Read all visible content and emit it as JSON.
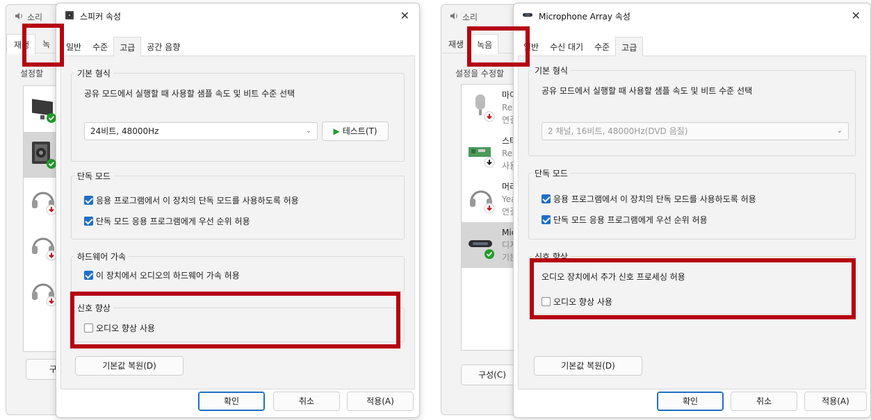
{
  "left": {
    "sound": {
      "title": "소리",
      "tabs": [
        "재생",
        "녹"
      ],
      "subtitle": "설정할",
      "button": "구성",
      "devices": [
        {
          "icon": "monitor-icon",
          "status": "green-check"
        },
        {
          "icon": "speaker-icon",
          "status": "green-check"
        },
        {
          "icon": "headset-icon",
          "status": "red-down"
        },
        {
          "icon": "headset-icon",
          "status": "red-down"
        },
        {
          "icon": "headset-icon",
          "status": "red-down"
        }
      ]
    },
    "dialog": {
      "title": "스피커 속성",
      "close": "✕",
      "tabs": [
        "일반",
        "수준",
        "고급",
        "공간 음향"
      ],
      "active_tab": 2,
      "default_format": {
        "legend": "기본 형식",
        "description": "공유 모드에서 실행할 때 사용할 샘플 속도 및 비트 수준 선택",
        "select_value": "24비트, 48000Hz",
        "test_label": "테스트(T)"
      },
      "exclusive": {
        "legend": "단독 모드",
        "allow_label": "응용 프로그램에서 이 장치의 단독 모드를 사용하도록 허용",
        "allow_checked": true,
        "priority_label": "단독 모드 응용 프로그램에게 우선 순위 허용",
        "priority_checked": true
      },
      "hardware": {
        "legend": "하드웨어 가속",
        "label": "이 장치에서 오디오의 하드웨어 가속 허용",
        "checked": true
      },
      "enhancement": {
        "legend": "신호 향상",
        "label": "오디오 향상 사용",
        "checked": false
      },
      "restore_label": "기본값 복원(D)",
      "ok": "확인",
      "cancel": "취소",
      "apply": "적용(A)"
    }
  },
  "right": {
    "sound": {
      "title": "소리",
      "tabs": [
        "재생",
        "녹음"
      ],
      "subtitle": "설정을 수정할",
      "button": "구성(C)",
      "devices": [
        {
          "icon": "microphone-icon",
          "name": "마이",
          "line2": "Real",
          "line3": "연결",
          "status": "red-down"
        },
        {
          "icon": "sound-card-icon",
          "name": "스테",
          "line2": "Real",
          "line3": "사용",
          "status": "down"
        },
        {
          "icon": "headset-icon",
          "name": "머리",
          "line2": "Yeal",
          "line3": "연결",
          "status": "red-down"
        },
        {
          "icon": "mic-array-icon",
          "name": "Micr",
          "line2": "디지",
          "line3": "기본",
          "status": "green-check"
        }
      ]
    },
    "dialog": {
      "title": "Microphone Array 속성",
      "close": "✕",
      "tabs": [
        "일반",
        "수신 대기",
        "수준",
        "고급"
      ],
      "active_tab": 3,
      "default_format": {
        "legend": "기본 형식",
        "description": "공유 모드에서 실행할 때 사용할 샘플 속도 및 비트 수준 선택",
        "select_value": "2 채널, 16비트, 48000Hz(DVD 음질)"
      },
      "exclusive": {
        "legend": "단독 모드",
        "allow_label": "응용 프로그램에서 이 장치의 단독 모드를 사용하도록 허용",
        "allow_checked": true,
        "priority_label": "단독 모드 응용 프로그램에게 우선 순위 허용",
        "priority_checked": true
      },
      "enhancement": {
        "legend": "신호 향상",
        "description": "오디오 장치에서 추가 신호 프로세싱 허용",
        "label": "오디오 향상 사용",
        "checked": false
      },
      "restore_label": "기본값 복원(D)",
      "ok": "확인",
      "cancel": "취소",
      "apply": "적용(A)"
    }
  },
  "colors": {
    "highlight": "#b5000f",
    "checkbox": "#1f6fc5",
    "primary_border": "#1f6fc5",
    "status_green": "#1f9d2a",
    "status_red": "#c0131b"
  }
}
